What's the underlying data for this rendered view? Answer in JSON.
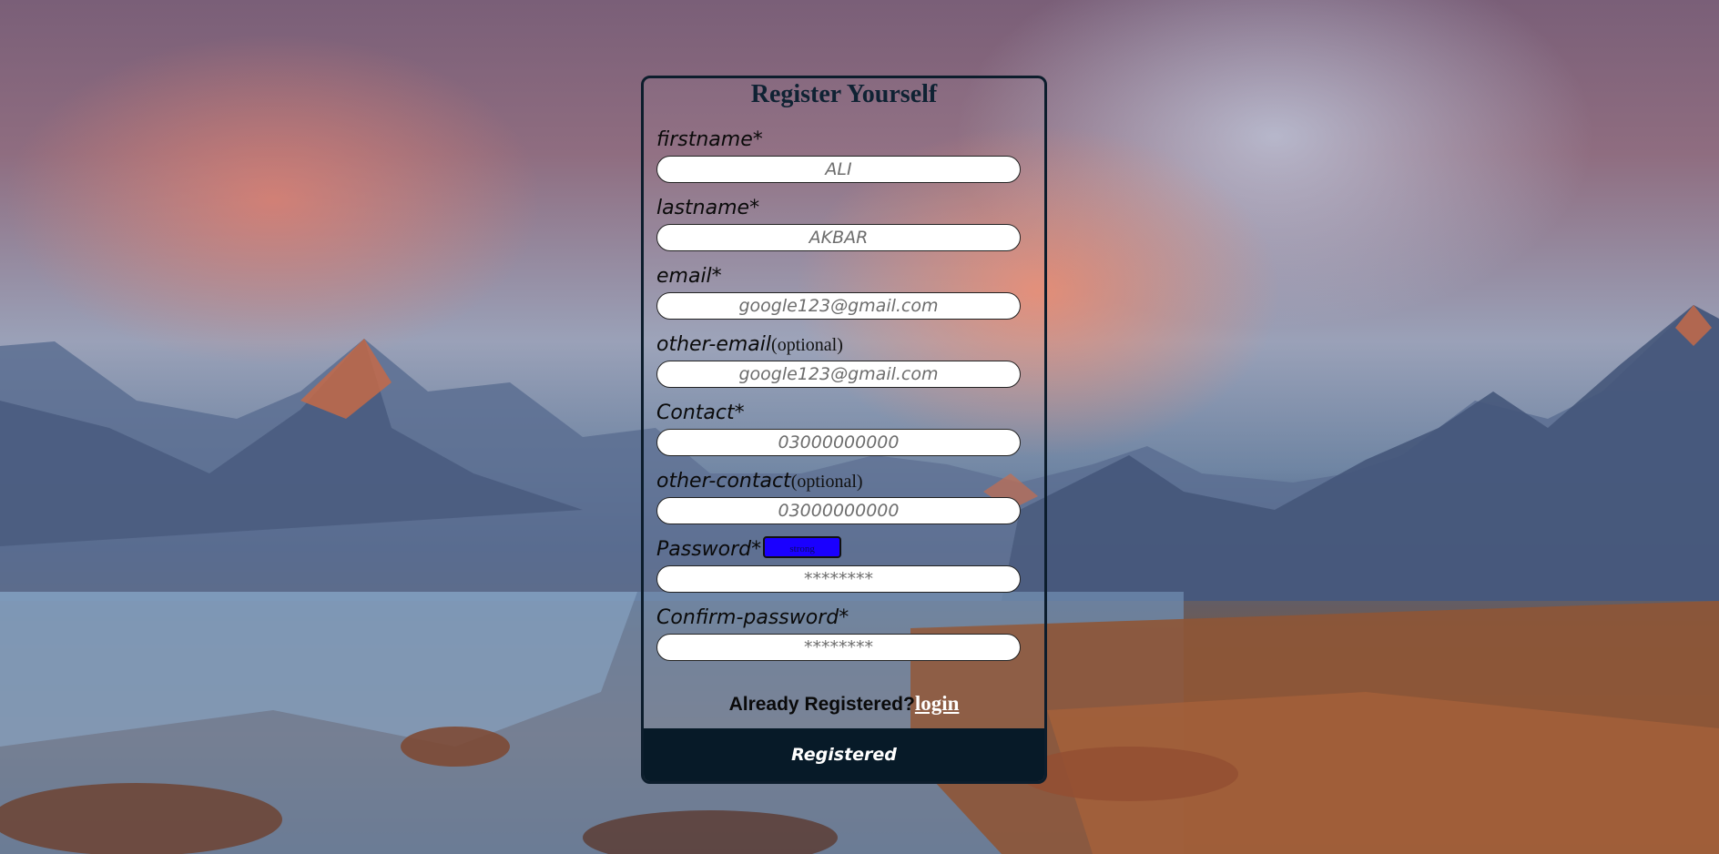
{
  "form": {
    "title": "Register Yourself",
    "fields": [
      {
        "label": "firstname*",
        "optional_note": "",
        "placeholder": "ALI"
      },
      {
        "label": "lastname*",
        "optional_note": "",
        "placeholder": "AKBAR"
      },
      {
        "label": "email*",
        "optional_note": "",
        "placeholder": "google123@gmail.com"
      },
      {
        "label": "other-email",
        "optional_note": "(optional)",
        "placeholder": "google123@gmail.com"
      },
      {
        "label": "Contact*",
        "optional_note": "",
        "placeholder": "03000000000"
      },
      {
        "label": "other-contact",
        "optional_note": "(optional)",
        "placeholder": "03000000000"
      },
      {
        "label": "Password*",
        "optional_note": "",
        "placeholder": "********"
      },
      {
        "label": "Confirm-password*",
        "optional_note": "",
        "placeholder": "********"
      }
    ],
    "password_strength": "strong",
    "already_registered_text": "Already Registered?",
    "login_link": "login",
    "submit_label": "Registered"
  },
  "colors": {
    "card_border": "#0c1d2c",
    "submit_bg": "#071a28",
    "strength_badge": "#1a00ff"
  }
}
